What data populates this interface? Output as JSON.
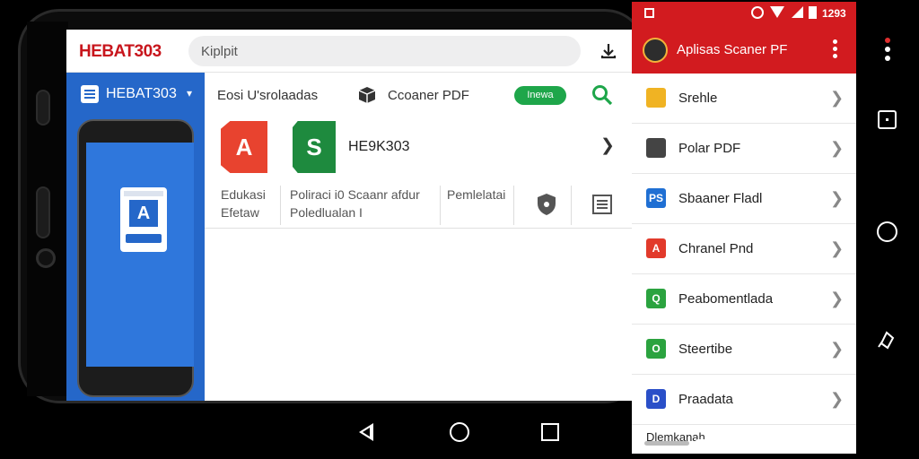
{
  "browser": {
    "brand": "HEBAT303",
    "search_value": "Kiplpit"
  },
  "left_panel": {
    "title": "HEBAT303",
    "card_letter": "A"
  },
  "content": {
    "tab_label": "Eosi U'srolaadas",
    "tab_scanner": "Ccoaner PDF",
    "new_badge": "Inewa",
    "app_a_letter": "A",
    "app_s_letter": "S",
    "app_name": "HE9K303",
    "info": [
      {
        "line1": "Edukasi",
        "line2": "Efetaw"
      },
      {
        "line1": "Poliraci i0 Scaanr afdur",
        "line2": "Poledlualan I"
      },
      {
        "line1": "Pemlelatai",
        "line2": ""
      }
    ]
  },
  "drawer": {
    "status_time": "1293",
    "title": "Aplisas Scaner PF",
    "items": [
      {
        "label": "Srehle",
        "icon_text": "",
        "color": "#f0b323"
      },
      {
        "label": "Polar PDF",
        "icon_text": "",
        "color": "#444444"
      },
      {
        "label": "Sbaaner Fladl",
        "icon_text": "PS",
        "color": "#1f6fd3"
      },
      {
        "label": "Chranel Pnd",
        "icon_text": "A",
        "color": "#e23a2b"
      },
      {
        "label": "Peabomentlada",
        "icon_text": "Q",
        "color": "#2ba33f"
      },
      {
        "label": "Steertibe",
        "icon_text": "O",
        "color": "#2ba33f"
      },
      {
        "label": "Praadata",
        "icon_text": "D",
        "color": "#2a4fc8"
      }
    ],
    "footer_label": "Dlemkanah"
  },
  "colors": {
    "brand_red": "#c8161d",
    "drawer_red": "#d21b1f",
    "panel_blue": "#2567c9",
    "badge_green": "#1ea64a"
  }
}
